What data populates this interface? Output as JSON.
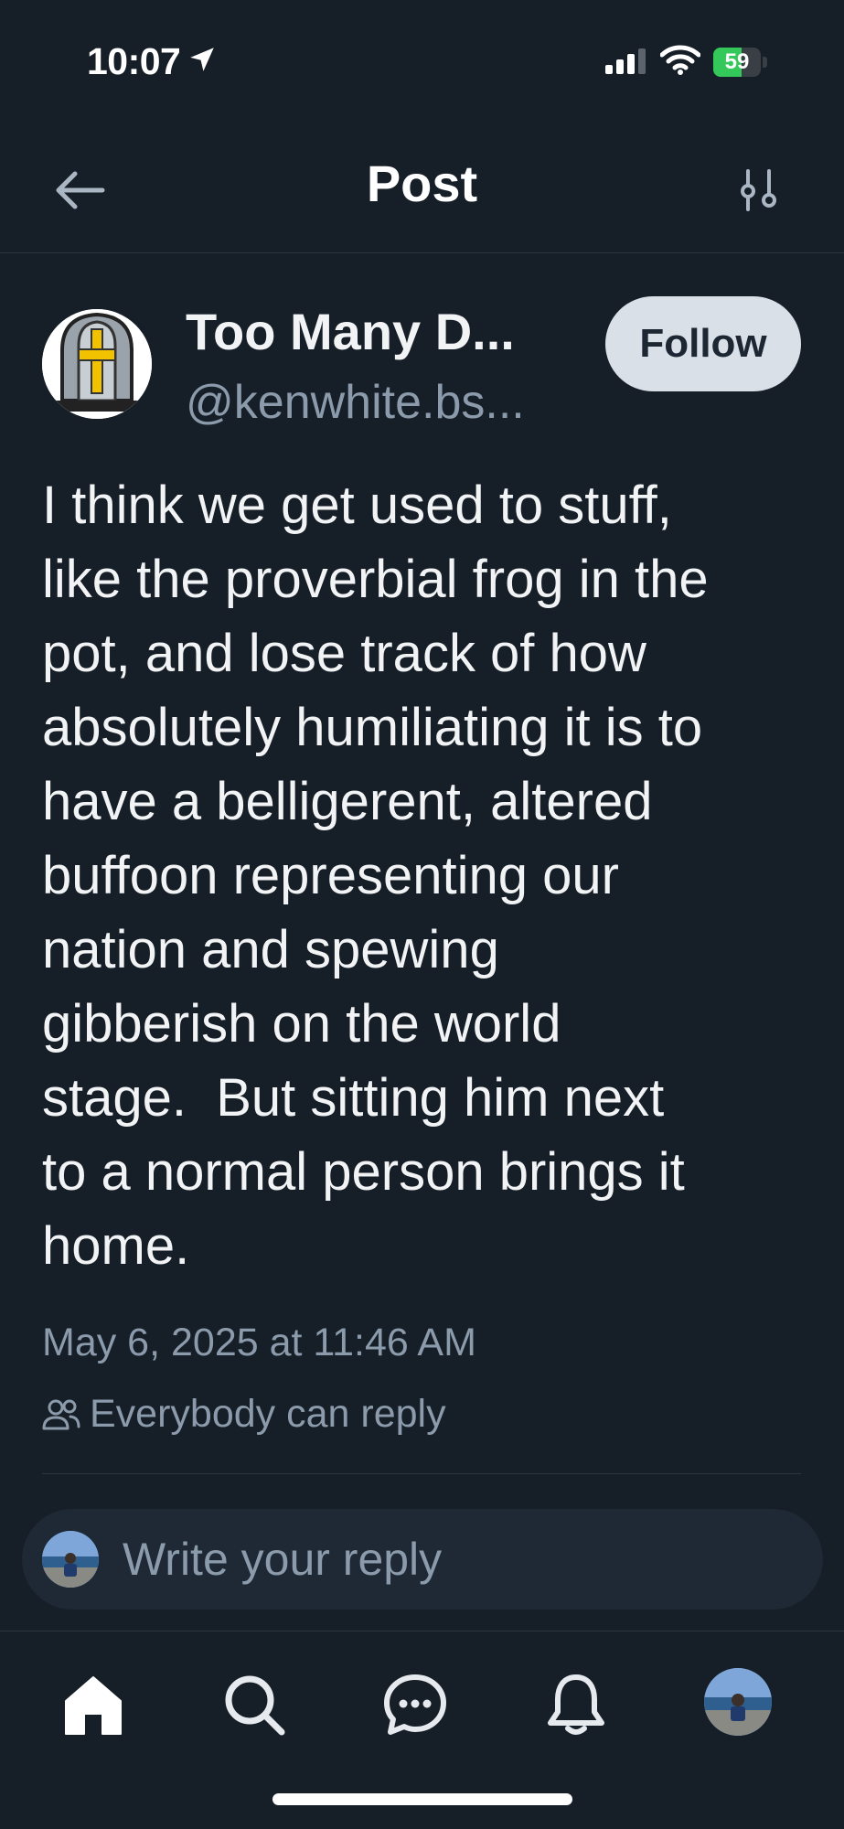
{
  "status_bar": {
    "time": "10:07",
    "battery": "59",
    "battery_level": 0.59
  },
  "header": {
    "title": "Post"
  },
  "post": {
    "author_name": "Too Many D...",
    "author_handle": "@kenwhite.bs...",
    "follow_label": "Follow",
    "text_lines": [
      "I think we get used to stuff,",
      "like the proverbial frog in the",
      "pot, and lose track of how",
      "absolutely humiliating it is to",
      "have a belligerent, altered",
      "buffoon representing our",
      "nation and spewing",
      "gibberish on the world",
      "stage.  But sitting him next",
      "to a normal person brings it",
      "home."
    ],
    "timestamp": "May 6, 2025 at 11:46 AM",
    "reply_setting": "Everybody can reply"
  },
  "reply_bar": {
    "placeholder": "Write your reply"
  },
  "tab_bar": {
    "tabs": [
      "home-icon",
      "search-icon",
      "chat-icon",
      "bell-icon",
      "profile-avatar"
    ]
  },
  "colors": {
    "background": "#161e27",
    "muted_text": "#8c9bab",
    "follow_bg": "#d9e0e8",
    "battery_green": "#34c759"
  }
}
